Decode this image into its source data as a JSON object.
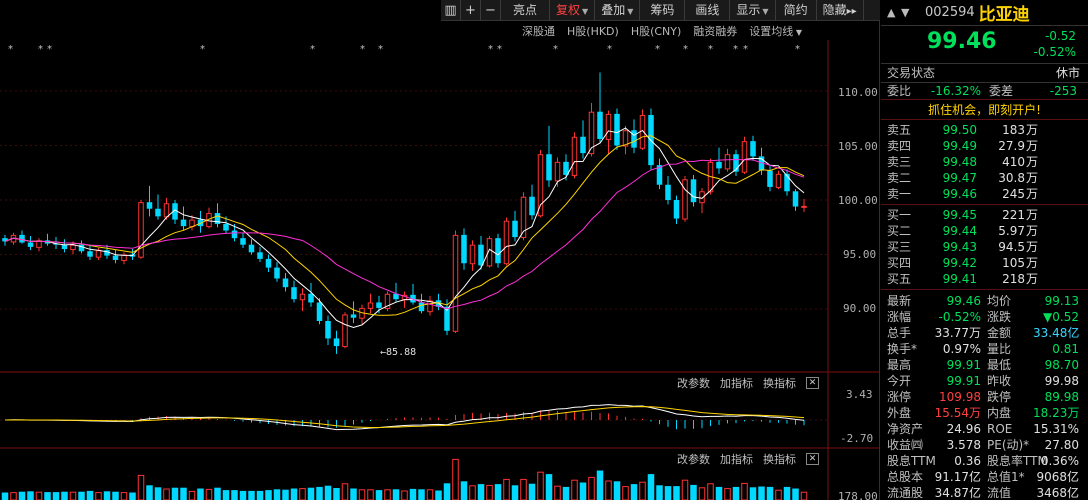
{
  "toolbar": {
    "buttons": [
      "亮点",
      "复权",
      "叠加",
      "筹码",
      "画线",
      "显示",
      "简约",
      "隐藏"
    ]
  },
  "sub_menu": [
    "深股通",
    "H股(HKD)",
    "H股(CNY)",
    "融资融券",
    "设置均线"
  ],
  "kline_panel": {
    "price_labels": [
      "110.00",
      "105.00",
      "100.00",
      "95.00",
      "90.00"
    ],
    "low_marker": "85.88",
    "candles": [
      [
        96.5,
        96.8,
        95.8,
        96.2
      ],
      [
        96.2,
        97.0,
        95.9,
        96.8
      ],
      [
        96.8,
        97.2,
        96.0,
        96.1
      ],
      [
        96.1,
        96.7,
        95.4,
        95.7
      ],
      [
        95.7,
        96.5,
        95.3,
        96.3
      ],
      [
        96.3,
        96.9,
        95.8,
        96.0
      ],
      [
        96.0,
        96.6,
        95.5,
        95.9
      ],
      [
        95.9,
        96.4,
        95.2,
        95.5
      ],
      [
        95.5,
        96.2,
        95.0,
        95.9
      ],
      [
        95.9,
        96.3,
        95.1,
        95.3
      ],
      [
        95.3,
        95.9,
        94.5,
        94.8
      ],
      [
        94.8,
        95.6,
        94.5,
        95.4
      ],
      [
        95.4,
        95.9,
        94.6,
        94.9
      ],
      [
        94.9,
        95.4,
        94.2,
        94.5
      ],
      [
        94.5,
        95.2,
        94.1,
        95.0
      ],
      [
        95.0,
        95.5,
        94.5,
        94.8
      ],
      [
        94.8,
        100.0,
        94.6,
        99.8
      ],
      [
        99.8,
        101.3,
        98.5,
        99.2
      ],
      [
        99.2,
        100.5,
        98.2,
        98.5
      ],
      [
        98.5,
        100.2,
        98.2,
        99.7
      ],
      [
        99.7,
        100.0,
        97.8,
        98.2
      ],
      [
        98.2,
        99.4,
        97.2,
        97.6
      ],
      [
        97.6,
        98.6,
        97.2,
        98.2
      ],
      [
        98.2,
        99.0,
        97.0,
        97.6
      ],
      [
        97.6,
        99.3,
        97.4,
        98.8
      ],
      [
        98.8,
        99.7,
        97.5,
        97.8
      ],
      [
        97.8,
        98.5,
        96.9,
        97.2
      ],
      [
        97.2,
        97.8,
        96.2,
        96.5
      ],
      [
        96.5,
        97.0,
        95.6,
        95.9
      ],
      [
        95.9,
        96.4,
        95.0,
        95.2
      ],
      [
        95.2,
        95.7,
        94.3,
        94.6
      ],
      [
        94.6,
        95.0,
        93.4,
        93.8
      ],
      [
        93.8,
        94.3,
        92.5,
        92.8
      ],
      [
        92.8,
        93.3,
        91.6,
        92.0
      ],
      [
        92.0,
        92.6,
        90.6,
        90.9
      ],
      [
        90.9,
        91.9,
        89.8,
        91.4
      ],
      [
        91.4,
        92.4,
        90.2,
        90.6
      ],
      [
        90.6,
        91.0,
        88.6,
        88.9
      ],
      [
        88.9,
        89.4,
        86.7,
        87.3
      ],
      [
        87.3,
        88.0,
        85.88,
        86.6
      ],
      [
        86.6,
        89.7,
        86.4,
        89.5
      ],
      [
        89.5,
        90.7,
        88.7,
        89.2
      ],
      [
        89.2,
        90.4,
        88.6,
        90.1
      ],
      [
        90.1,
        91.4,
        89.6,
        90.6
      ],
      [
        90.6,
        91.2,
        89.6,
        90.1
      ],
      [
        90.1,
        91.6,
        89.8,
        91.4
      ],
      [
        91.4,
        92.4,
        90.6,
        90.9
      ],
      [
        90.9,
        91.6,
        90.1,
        91.3
      ],
      [
        91.3,
        92.3,
        90.4,
        90.6
      ],
      [
        90.6,
        91.4,
        89.6,
        89.8
      ],
      [
        89.8,
        91.2,
        89.4,
        90.8
      ],
      [
        90.8,
        91.4,
        89.9,
        90.2
      ],
      [
        90.2,
        90.9,
        87.6,
        88.0
      ],
      [
        88.0,
        97.2,
        87.8,
        96.8
      ],
      [
        96.8,
        97.4,
        93.6,
        94.2
      ],
      [
        94.2,
        96.3,
        93.5,
        95.9
      ],
      [
        95.9,
        96.7,
        93.6,
        94.0
      ],
      [
        94.0,
        96.7,
        93.8,
        96.5
      ],
      [
        96.5,
        96.9,
        93.8,
        94.2
      ],
      [
        94.2,
        98.4,
        94.0,
        98.1
      ],
      [
        98.1,
        99.0,
        96.2,
        96.6
      ],
      [
        96.6,
        100.7,
        96.3,
        100.3
      ],
      [
        100.3,
        101.4,
        98.2,
        98.6
      ],
      [
        98.6,
        104.6,
        98.4,
        104.2
      ],
      [
        104.2,
        106.8,
        101.2,
        101.8
      ],
      [
        101.8,
        103.9,
        101.2,
        103.5
      ],
      [
        103.5,
        104.2,
        101.8,
        102.3
      ],
      [
        102.3,
        106.2,
        102.0,
        105.8
      ],
      [
        105.8,
        107.3,
        103.8,
        104.3
      ],
      [
        104.3,
        108.9,
        104.0,
        108.1
      ],
      [
        108.1,
        111.7,
        105.2,
        105.6
      ],
      [
        105.6,
        108.2,
        104.2,
        107.9
      ],
      [
        107.9,
        108.4,
        104.6,
        105.0
      ],
      [
        105.0,
        106.8,
        104.2,
        106.4
      ],
      [
        106.4,
        107.4,
        104.3,
        104.8
      ],
      [
        104.8,
        108.3,
        104.6,
        107.8
      ],
      [
        107.8,
        108.4,
        102.8,
        103.2
      ],
      [
        103.2,
        103.8,
        101.0,
        101.4
      ],
      [
        101.4,
        102.2,
        99.6,
        100.0
      ],
      [
        100.0,
        100.4,
        97.8,
        98.3
      ],
      [
        98.3,
        102.2,
        98.0,
        101.9
      ],
      [
        101.9,
        102.3,
        99.4,
        99.8
      ],
      [
        99.8,
        101.1,
        98.8,
        100.8
      ],
      [
        100.8,
        103.8,
        100.5,
        103.5
      ],
      [
        103.5,
        104.8,
        102.4,
        102.9
      ],
      [
        102.9,
        104.7,
        102.6,
        104.2
      ],
      [
        104.2,
        104.6,
        102.2,
        102.6
      ],
      [
        102.6,
        105.8,
        102.4,
        105.4
      ],
      [
        105.4,
        105.9,
        103.6,
        104.0
      ],
      [
        104.0,
        104.8,
        102.3,
        102.7
      ],
      [
        102.7,
        103.2,
        100.8,
        101.2
      ],
      [
        101.2,
        102.7,
        101.0,
        102.4
      ],
      [
        102.4,
        102.8,
        100.4,
        100.8
      ],
      [
        100.8,
        101.0,
        99.0,
        99.4
      ],
      [
        99.4,
        100.1,
        98.9,
        99.46
      ]
    ]
  },
  "macd_panel": {
    "buttons": [
      "改参数",
      "加指标",
      "换指标"
    ],
    "labels": [
      "3.43",
      "-2.70"
    ]
  },
  "vol_panel": {
    "buttons": [
      "改参数",
      "加指标",
      "换指标"
    ],
    "labels": [
      "178.00"
    ]
  },
  "quote": {
    "code": "002594",
    "name": "比亚迪",
    "price": "99.46",
    "change": "-0.52",
    "change_pct": "-0.52%",
    "status_label": "交易状态",
    "status_value": "休市",
    "wb_label": "委比",
    "wb_value": "-16.32%",
    "wc_label": "委差",
    "wc_value": "-253",
    "promo": "抓住机会，即刻开户!",
    "asks": [
      {
        "label": "卖五",
        "price": "99.50",
        "vol": "183",
        "unit": "万"
      },
      {
        "label": "卖四",
        "price": "99.49",
        "vol": "27.9",
        "unit": "万"
      },
      {
        "label": "卖三",
        "price": "99.48",
        "vol": "410",
        "unit": "万"
      },
      {
        "label": "卖二",
        "price": "99.47",
        "vol": "30.8",
        "unit": "万"
      },
      {
        "label": "卖一",
        "price": "99.46",
        "vol": "245",
        "unit": "万"
      }
    ],
    "bids": [
      {
        "label": "买一",
        "price": "99.45",
        "vol": "221",
        "unit": "万"
      },
      {
        "label": "买二",
        "price": "99.44",
        "vol": "5.97",
        "unit": "万"
      },
      {
        "label": "买三",
        "price": "99.43",
        "vol": "94.5",
        "unit": "万"
      },
      {
        "label": "买四",
        "price": "99.42",
        "vol": "105",
        "unit": "万"
      },
      {
        "label": "买五",
        "price": "99.41",
        "vol": "218",
        "unit": "万"
      }
    ],
    "stats": [
      {
        "l1": "最新",
        "v1": "99.46",
        "c1": "g",
        "l2": "均价",
        "v2": "99.13",
        "c2": "g"
      },
      {
        "l1": "涨幅",
        "v1": "-0.52%",
        "c1": "g",
        "l2": "涨跌",
        "v2": "▼0.52",
        "c2": "g"
      },
      {
        "l1": "总手",
        "v1": "33.77万",
        "c1": "w",
        "l2": "金额",
        "v2": "33.48亿",
        "c2": "c"
      },
      {
        "l1": "换手*",
        "v1": "0.97%",
        "c1": "w",
        "l2": "量比",
        "v2": "0.81",
        "c2": "g"
      },
      {
        "l1": "最高",
        "v1": "99.91",
        "c1": "g",
        "l2": "最低",
        "v2": "98.70",
        "c2": "g"
      },
      {
        "l1": "今开",
        "v1": "99.91",
        "c1": "g",
        "l2": "昨收",
        "v2": "99.98",
        "c2": "w"
      },
      {
        "l1": "涨停",
        "v1": "109.98",
        "c1": "r",
        "l2": "跌停",
        "v2": "89.98",
        "c2": "g"
      },
      {
        "l1": "外盘",
        "v1": "15.54万",
        "c1": "r",
        "l2": "内盘",
        "v2": "18.23万",
        "c2": "g"
      },
      {
        "l1": "净资产",
        "v1": "24.96",
        "c1": "w",
        "l2": "ROE",
        "v2": "15.31%",
        "c2": "w"
      },
      {
        "l1": "收益㈣",
        "v1": "3.578",
        "c1": "w",
        "l2": "PE(动)*",
        "v2": "27.80",
        "c2": "w"
      },
      {
        "l1": "股息TTM",
        "v1": "0.36",
        "c1": "w",
        "l2": "股息率TTM",
        "v2": "0.36%",
        "c2": "w"
      },
      {
        "l1": "总股本",
        "v1": "91.17亿",
        "c1": "w",
        "l2": "总值1*",
        "v2": "9068亿",
        "c2": "w"
      },
      {
        "l1": "流通股",
        "v1": "34.87亿",
        "c1": "w",
        "l2": "流值",
        "v2": "3468亿",
        "c2": "w"
      }
    ]
  },
  "colors": {
    "up": "#ff3333",
    "down": "#00d8ff",
    "ma5": "#ffffff",
    "ma10": "#ffd400",
    "ma20": "#ff2fd8"
  }
}
